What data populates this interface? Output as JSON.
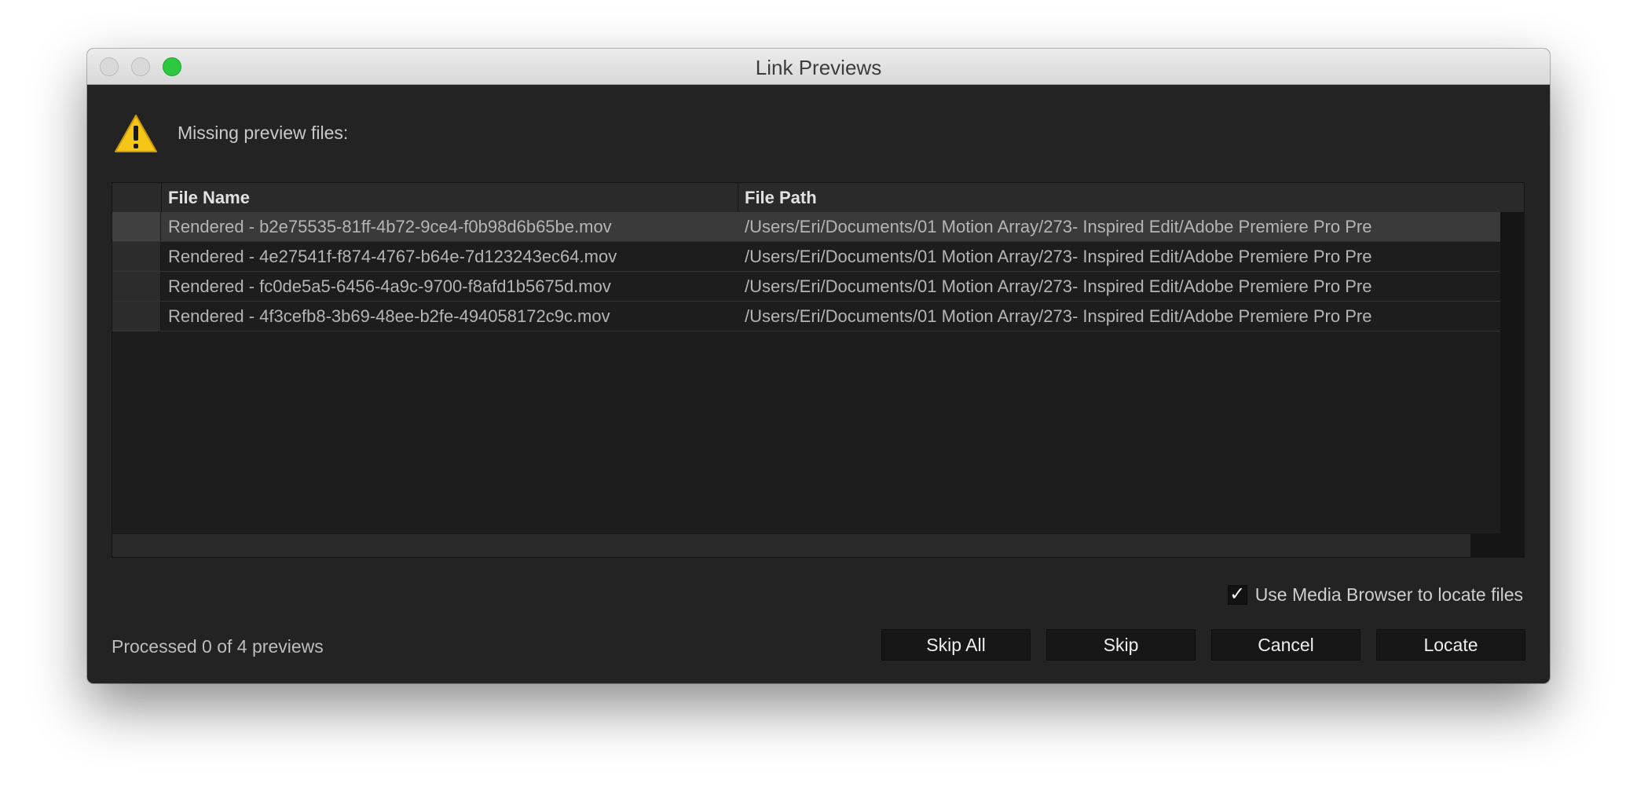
{
  "window": {
    "title": "Link Previews"
  },
  "message": {
    "label": "Missing preview files:",
    "icon": "warning-icon"
  },
  "table": {
    "columns": [
      "File Name",
      "File Path"
    ],
    "rows": [
      {
        "name": "Rendered - b2e75535-81ff-4b72-9ce4-f0b98d6b65be.mov",
        "path": "/Users/Eri/Documents/01 Motion Array/273- Inspired Edit/Adobe Premiere Pro Pre"
      },
      {
        "name": "Rendered - 4e27541f-f874-4767-b64e-7d123243ec64.mov",
        "path": "/Users/Eri/Documents/01 Motion Array/273- Inspired Edit/Adobe Premiere Pro Pre"
      },
      {
        "name": "Rendered - fc0de5a5-6456-4a9c-9700-f8afd1b5675d.mov",
        "path": "/Users/Eri/Documents/01 Motion Array/273- Inspired Edit/Adobe Premiere Pro Pre"
      },
      {
        "name": "Rendered - 4f3cefb8-3b69-48ee-b2fe-494058172c9c.mov",
        "path": "/Users/Eri/Documents/01 Motion Array/273- Inspired Edit/Adobe Premiere Pro Pre"
      }
    ]
  },
  "options": {
    "use_media_browser_label": "Use Media Browser to locate files",
    "use_media_browser_checked": true,
    "check_mark": "✓"
  },
  "status": {
    "text": "Processed 0 of 4 previews"
  },
  "buttons": {
    "skip_all": "Skip All",
    "skip": "Skip",
    "cancel": "Cancel",
    "locate": "Locate"
  },
  "colors": {
    "window_bg": "#232323",
    "zoom_button": "#2ec840",
    "warning_yellow": "#f5c518"
  }
}
